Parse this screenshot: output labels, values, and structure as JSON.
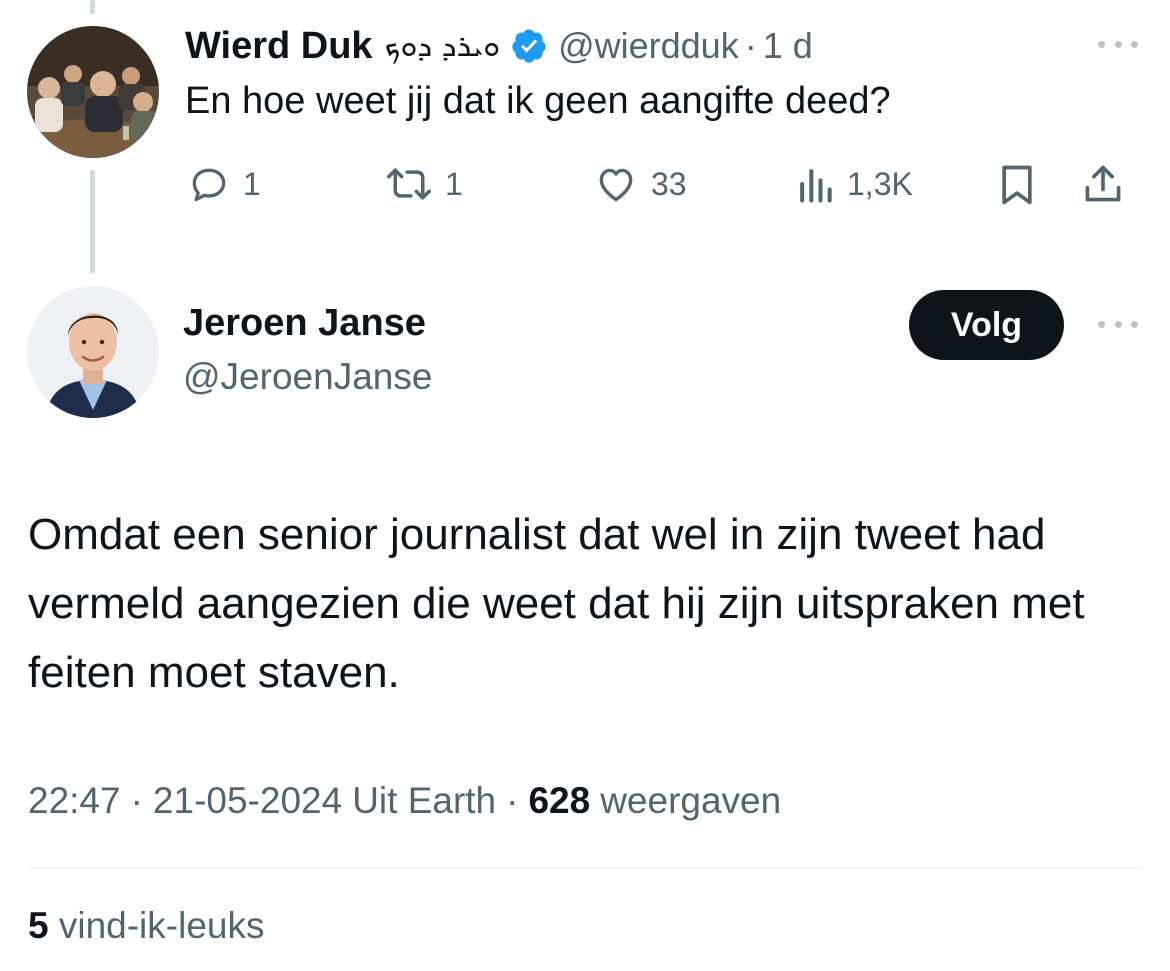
{
  "parent_tweet": {
    "author_name": "Wierd Duk",
    "author_script": "ܘܝܪܕ ܕܘܟ",
    "handle": "@wierdduk",
    "separator": "·",
    "time_ago": "1 d",
    "text": "En hoe weet jij dat ik geen aangifte deed?",
    "actions": {
      "replies": "1",
      "retweets": "1",
      "likes": "33",
      "views": "1,3K"
    }
  },
  "main_tweet": {
    "author_name": "Jeroen Janse",
    "handle": "@JeroenJanse",
    "follow_label": "Volg",
    "text": "Omdat een senior journalist dat wel in zijn tweet had vermeld aangezien die weet dat hij zijn uitspraken met feiten moet staven.",
    "time": "22:47",
    "date": "21-05-2024",
    "source": "Uit Earth",
    "separator": "·",
    "views_count": "628",
    "views_label": "weergaven",
    "likes_count": "5",
    "likes_label": "vind-ik-leuks"
  },
  "colors": {
    "text_primary": "#0f1419",
    "text_secondary": "#536471",
    "verified_blue": "#1d9bf0",
    "thread_line": "#cfd9de",
    "follow_button_bg": "#0f1419"
  },
  "icons": [
    "reply-icon",
    "retweet-icon",
    "like-icon",
    "views-icon",
    "bookmark-icon",
    "share-icon",
    "verified-badge-icon",
    "more-icon"
  ]
}
